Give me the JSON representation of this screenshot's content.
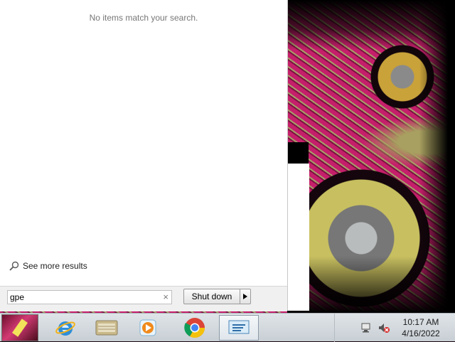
{
  "start_menu": {
    "empty_message": "No items match your search.",
    "see_more_label": "See more results",
    "search_value": "gpe",
    "search_clear_glyph": "×",
    "shutdown_label": "Shut down"
  },
  "taskbar": {
    "pinned": [
      {
        "name": "internet-explorer-icon"
      },
      {
        "name": "explorer-folder-icon"
      },
      {
        "name": "media-player-icon"
      },
      {
        "name": "chrome-icon"
      },
      {
        "name": "remote-desktop-icon"
      }
    ],
    "clock_time": "10:17 AM",
    "clock_date": "4/16/2022"
  },
  "colors": {
    "accent_pink": "#c51f6b",
    "accent_olive": "#a7a06a"
  }
}
